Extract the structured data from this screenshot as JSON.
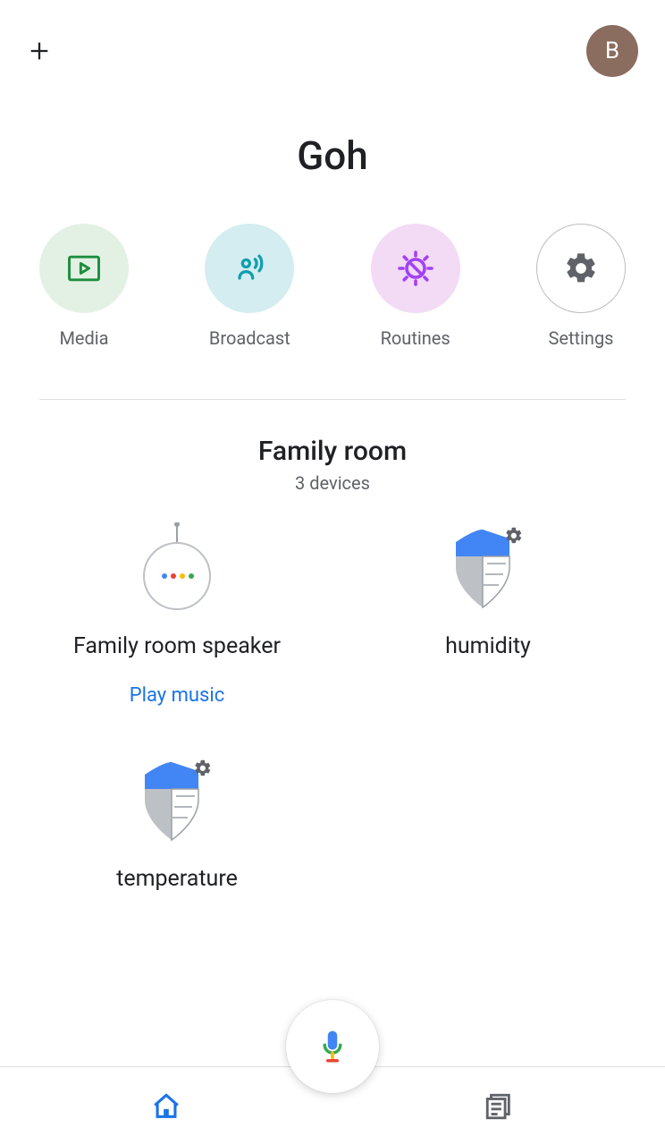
{
  "header": {
    "avatar_initial": "B"
  },
  "home": {
    "title": "Goh"
  },
  "actions": {
    "media": "Media",
    "broadcast": "Broadcast",
    "routines": "Routines",
    "settings": "Settings"
  },
  "room": {
    "name": "Family room",
    "subtitle": "3 devices"
  },
  "devices": [
    {
      "label": "Family room speaker",
      "action": "Play music"
    },
    {
      "label": "humidity"
    },
    {
      "label": "temperature"
    }
  ]
}
